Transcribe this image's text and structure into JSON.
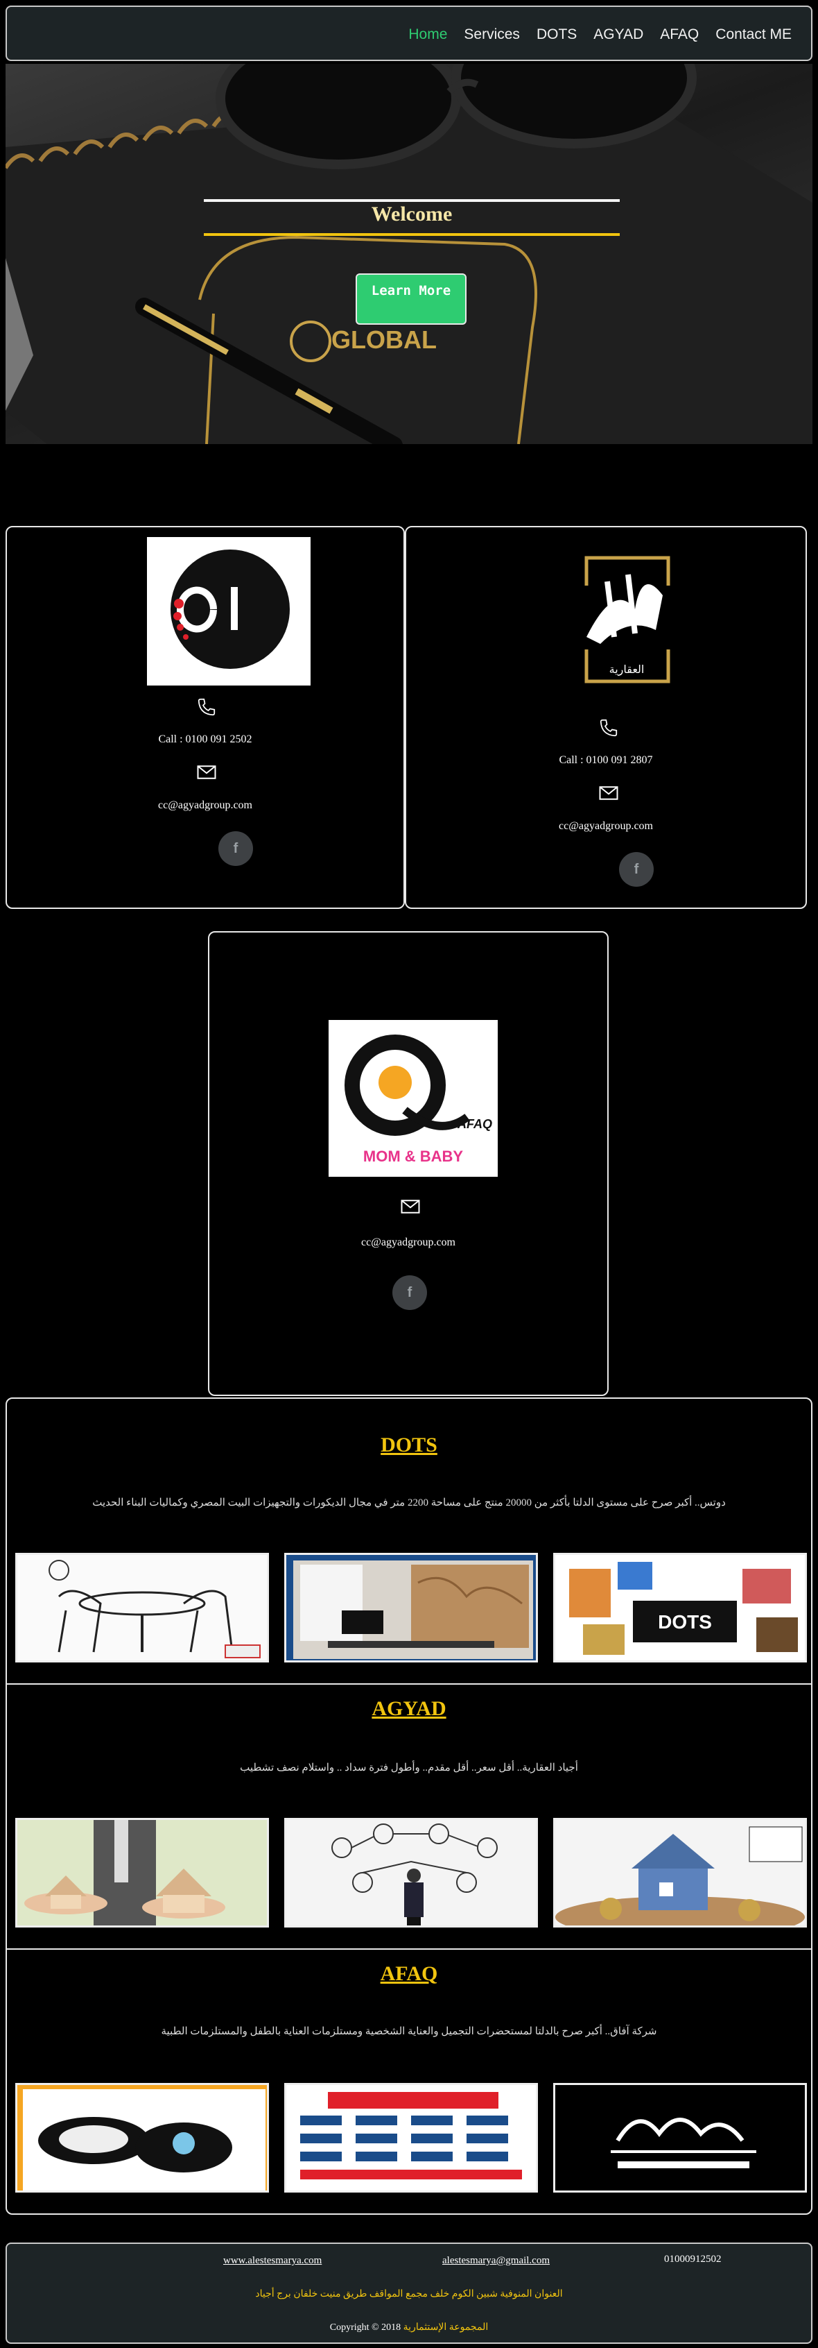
{
  "nav": {
    "items": [
      {
        "label": "Home",
        "active": true
      },
      {
        "label": "Services"
      },
      {
        "label": "DOTS"
      },
      {
        "label": "AGYAD"
      },
      {
        "label": "AFAQ"
      },
      {
        "label": "Contact ME"
      }
    ]
  },
  "hero": {
    "title": "Welcome",
    "button": "Learn More",
    "book_text": "GLOBAL"
  },
  "cards": {
    "dots": {
      "phone": "Call : 0100 091 2502",
      "email": "cc@agyadgroup.com",
      "fb": "f"
    },
    "agyad": {
      "phone": "Call : 0100 091 2807",
      "email": "cc@agyadgroup.com",
      "fb": "f",
      "logo_sub": "العقارية"
    },
    "afaq": {
      "email": "cc@agyadgroup.com",
      "fb": "f",
      "logo_text": "AFAQ",
      "logo_sub": "MOM & BABY"
    }
  },
  "sections": {
    "dots": {
      "title": "DOTS",
      "desc": "دوتس.. أكبر صرح على مستوى الدلتا بأكثر من 20000 منتج على مساحة 2200 متر في مجال الديكورات والتجهيزات البيت المصري وكماليات البناء الحديث"
    },
    "agyad": {
      "title": "AGYAD",
      "desc": "أجياد العقارية.. أقل سعر.. أقل مقدم.. وأطول فترة سداد .. واستلام نصف تشطيب"
    },
    "afaq": {
      "title": "AFAQ",
      "desc": "شركة آفاق.. أكبر صرح بالدلتا لمستحضرات التجميل والعناية الشخصية ومستلزمات العناية بالطفل والمستلزمات الطبية"
    }
  },
  "footer": {
    "website": "www.alestesmarya.com",
    "email": "alestesmarya@gmail.com",
    "phone": "01000912502",
    "address": "العنوان المنوفية شبين الكوم خلف مجمع المواقف طريق منيت خلفان برج أجياد",
    "copyright_prefix": "Copyright © 2018",
    "copyright_brand": "المجموعة الإستثمارية"
  },
  "colors": {
    "accent_green": "#2ecc71",
    "accent_gold": "#f1c40f",
    "nav_bg": "#1d2426"
  }
}
